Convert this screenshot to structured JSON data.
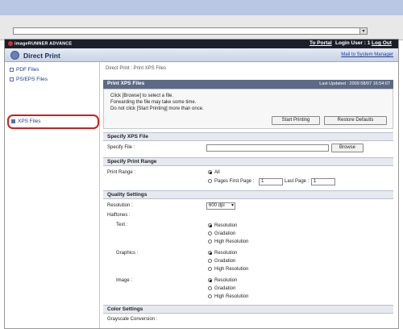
{
  "browser": {
    "url": ""
  },
  "header": {
    "brand": "imageRUNNER ADVANCE",
    "to_portal": "To Portal",
    "login_user": "Login User : 1",
    "log_out": "Log Out",
    "app_title": "Direct Print",
    "mail_link": "Mail to System Manager"
  },
  "sidebar": {
    "items": [
      {
        "label": "PDF Files"
      },
      {
        "label": "PS/EPS Files"
      },
      {
        "label": "XPS Files",
        "selected": true
      }
    ]
  },
  "main": {
    "breadcrumb": "Direct Print : Print XPS Files",
    "panel_title": "Print XPS Files",
    "last_updated": "Last Updated : 2009 08/07 16:54:07",
    "instructions": [
      "Click [Browse] to select a file.",
      "Forwarding the file may take some time.",
      "Do not click [Start Printing] more than once."
    ],
    "start_printing": "Start Printing",
    "restore_defaults": "Restore Defaults",
    "specify_file_section": "Specify XPS File",
    "specify_file_label": "Specify File :",
    "browse": "Browse",
    "print_range_section": "Specify Print Range",
    "print_range_label": "Print Range :",
    "range_all": "All",
    "range_pages": "Pages First Page :",
    "first_page_value": "1",
    "last_page_label": "Last Page :",
    "last_page_value": "1",
    "quality_section": "Quality Settings",
    "resolution_label": "Resolution :",
    "resolution_value": "600 dpi",
    "halftones_label": "Halftones :",
    "text_label": "Text :",
    "graphics_label": "Graphics :",
    "image_label": "Image :",
    "halftone_options": [
      "Resolution",
      "Gradation",
      "High Resolution"
    ],
    "color_section": "Color Settings",
    "grayscale_label": "Grayscale Conversion :"
  },
  "colors": {
    "accent_header": "#5c6a86",
    "highlight_red": "#d41c1c",
    "link_blue": "#1a3a9a"
  }
}
